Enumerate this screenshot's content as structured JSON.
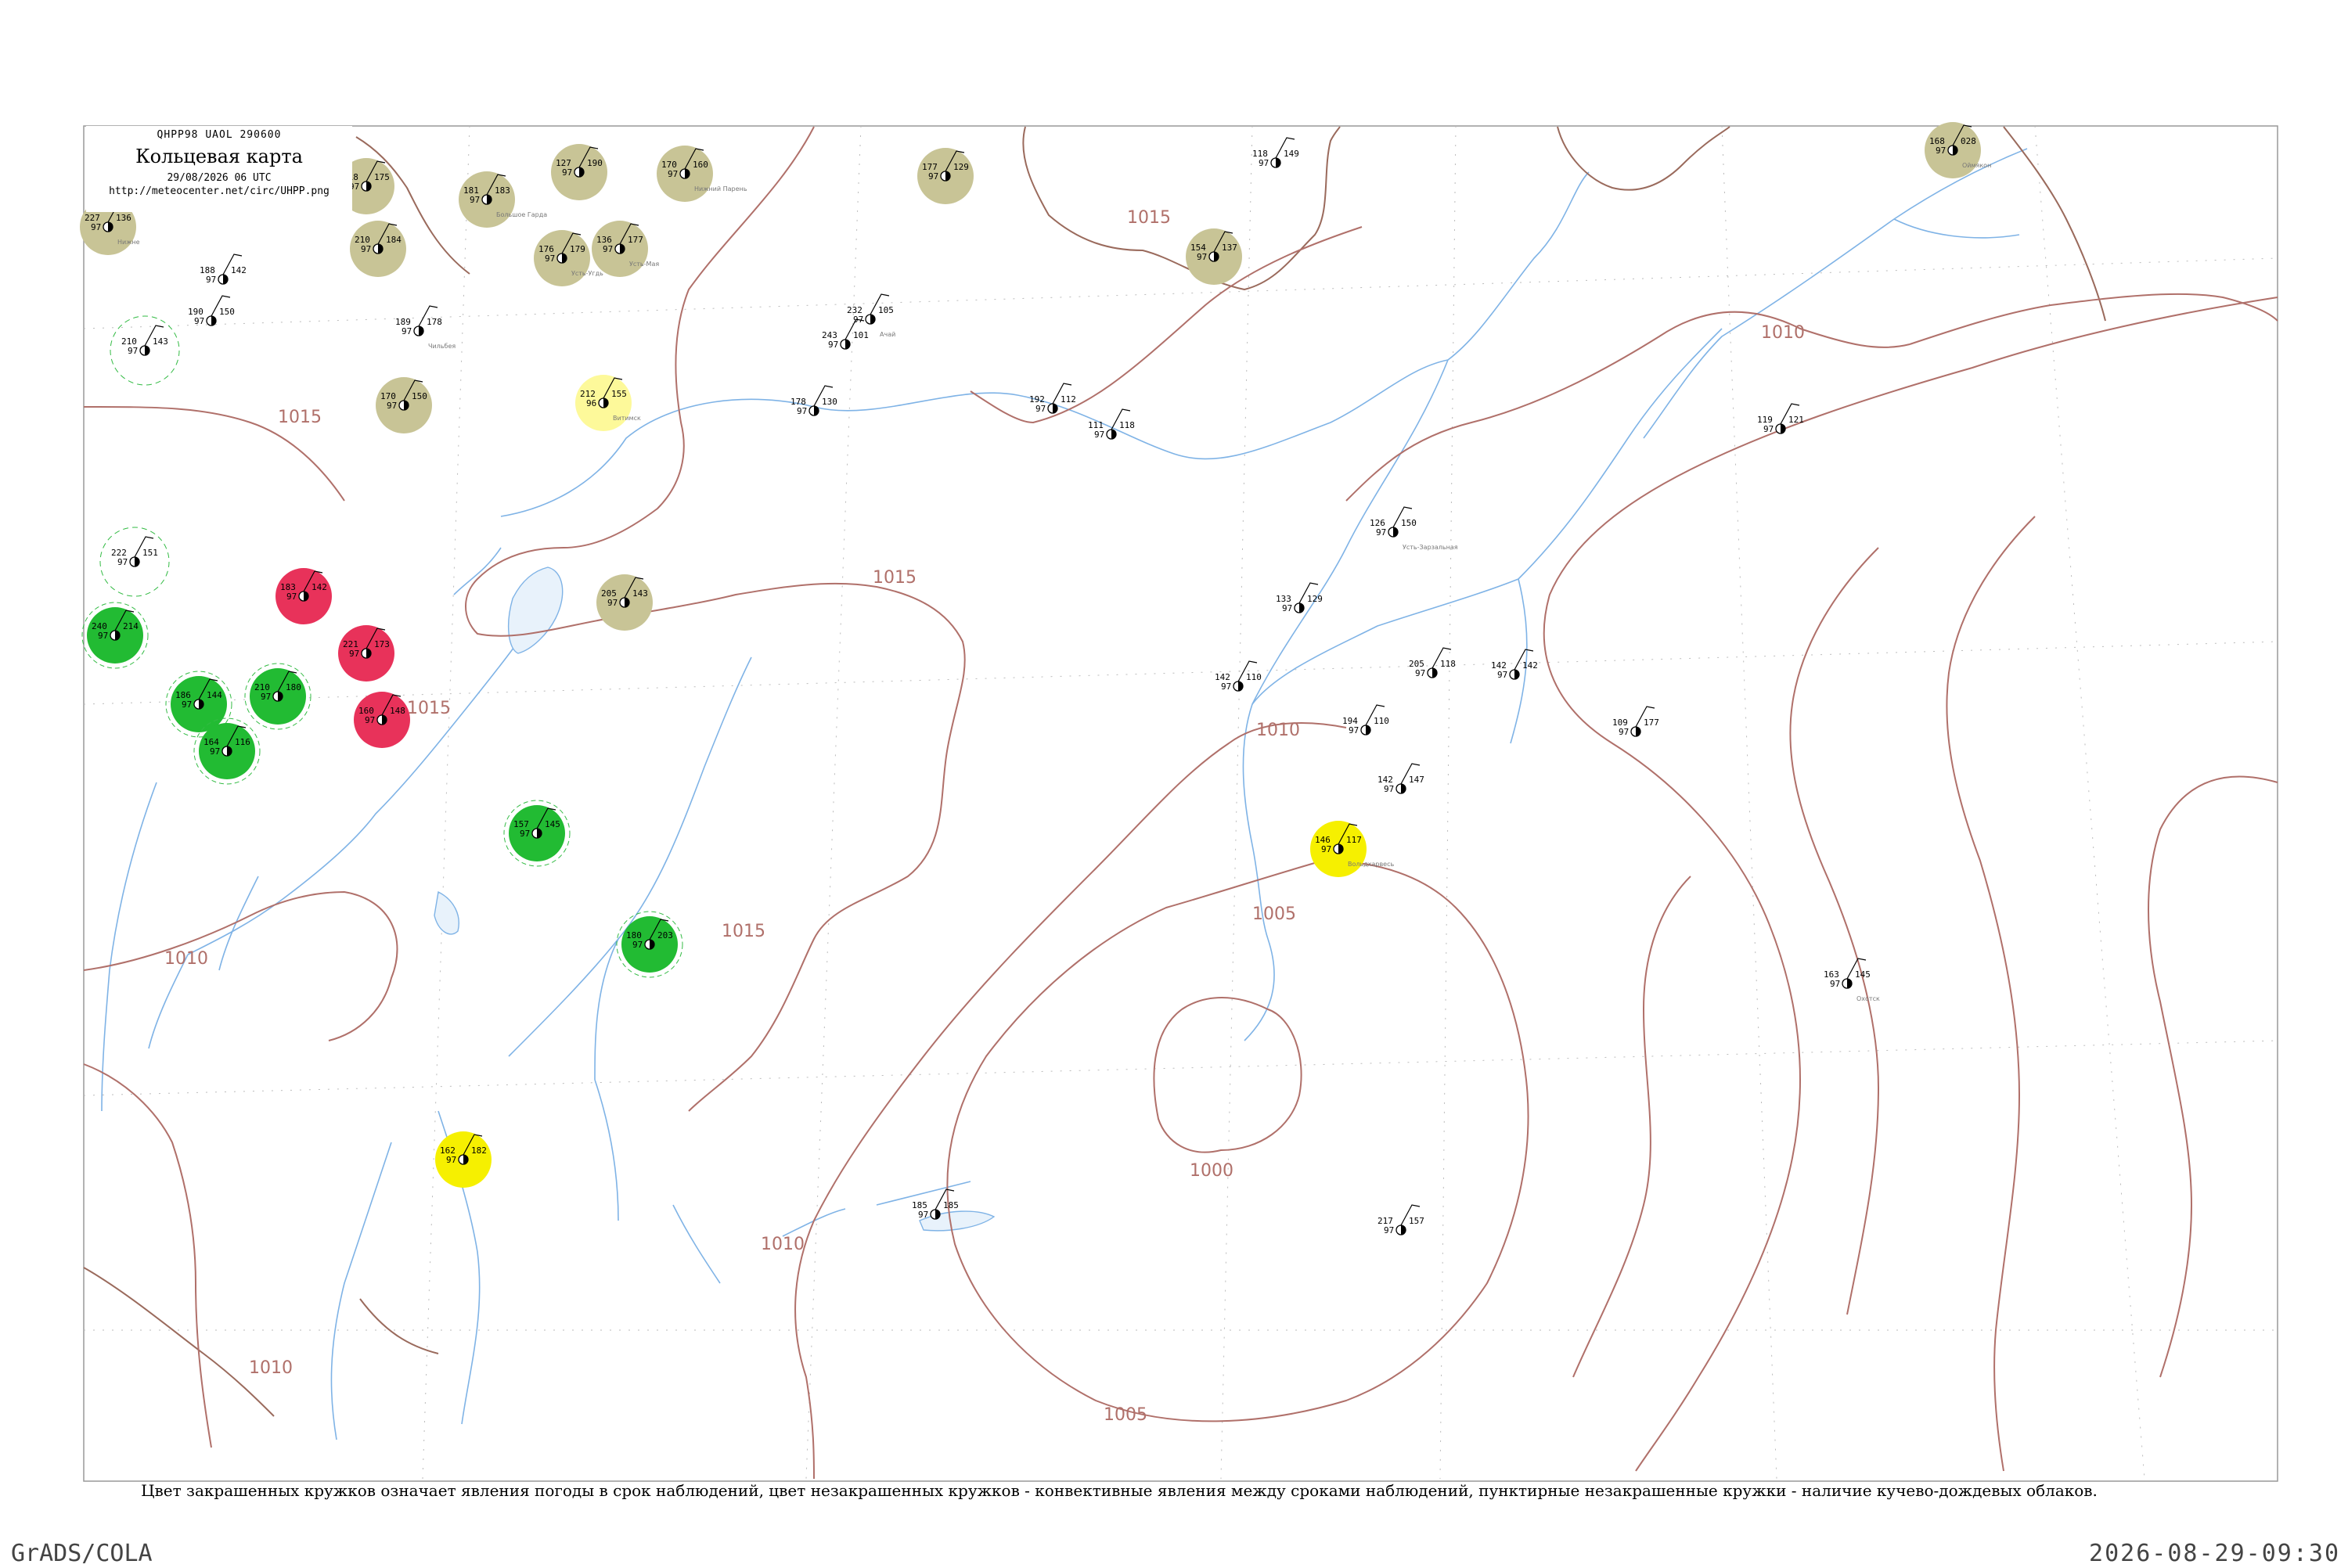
{
  "header": {
    "code": "QHPP98  UAOL  290600",
    "title": "Кольцевая карта",
    "datetime": "29/08/2026 06 UTC",
    "url": "http://meteocenter.net/circ/UHPP.png"
  },
  "caption": "Цвет закрашенных кружков означает явления погоды в срок наблюдений, цвет незакрашенных кружков - конвективные явления между сроками наблюдений, пунктирные незакрашенные кружки - наличие кучево-дождевых облаков.",
  "footer": {
    "left": "GrADS/COLA",
    "right": "2026-08-29-09:30"
  },
  "colors": {
    "isobar": "#b0706a",
    "river": "#7fb3e6",
    "khaki": "#c8c496",
    "green": "#22bb33",
    "red": "#e8325a",
    "yellow": "#f6f000",
    "paleyellow": "#fdf99a",
    "dashed": "#33bb44"
  },
  "isobar_labels": [
    "1015",
    "1015",
    "1015",
    "1015",
    "1015",
    "1010",
    "1010",
    "1010",
    "1010",
    "1005",
    "1000",
    "1005",
    "1010"
  ],
  "stations": [
    {
      "temp": "227",
      "td": "136",
      "p": "97",
      "name": "Нижне",
      "kind": "khaki"
    },
    {
      "temp": "218",
      "td": "175",
      "p": "97",
      "name": "",
      "kind": "khaki"
    },
    {
      "temp": "181",
      "td": "183",
      "p": "97",
      "name": "Большое Гарда",
      "kind": "khaki"
    },
    {
      "temp": "127",
      "td": "190",
      "p": "97",
      "name": "",
      "kind": "khaki"
    },
    {
      "temp": "170",
      "td": "160",
      "p": "97",
      "name": "Нижний Парень",
      "kind": "khaki"
    },
    {
      "temp": "210",
      "td": "184",
      "p": "97",
      "name": "",
      "kind": "khaki"
    },
    {
      "temp": "176",
      "td": "179",
      "p": "97",
      "name": "Усть-Угдь",
      "kind": "khaki"
    },
    {
      "temp": "136",
      "td": "177",
      "p": "97",
      "name": "Усть-Мая",
      "kind": "khaki"
    },
    {
      "temp": "177",
      "td": "129",
      "p": "97",
      "name": "",
      "kind": "khaki"
    },
    {
      "temp": "154",
      "td": "137",
      "p": "97",
      "name": "",
      "kind": "khaki"
    },
    {
      "temp": "170",
      "td": "150",
      "p": "97",
      "name": "",
      "kind": "khaki"
    },
    {
      "temp": "205",
      "td": "143",
      "p": "97",
      "name": "",
      "kind": "khaki"
    },
    {
      "temp": "168",
      "td": "028",
      "p": "97",
      "name": "Оймякон",
      "kind": "khaki"
    },
    {
      "temp": "212",
      "td": "155",
      "p": "96",
      "name": "Витимск",
      "kind": "paleyellow"
    },
    {
      "temp": "146",
      "td": "117",
      "p": "97",
      "name": "Вольдхарвесь",
      "kind": "yellow"
    },
    {
      "temp": "162",
      "td": "182",
      "p": "97",
      "name": "",
      "kind": "yellow"
    },
    {
      "temp": "222",
      "td": "151",
      "p": "97",
      "name": "",
      "kind": "dashed"
    },
    {
      "temp": "210",
      "td": "143",
      "p": "97",
      "name": "",
      "kind": "dashed"
    },
    {
      "temp": "240",
      "td": "214",
      "p": "97",
      "name": "",
      "kind": "green"
    },
    {
      "temp": "186",
      "td": "144",
      "p": "97",
      "name": "",
      "kind": "green"
    },
    {
      "temp": "164",
      "td": "116",
      "p": "97",
      "name": "",
      "kind": "green"
    },
    {
      "temp": "210",
      "td": "180",
      "p": "97",
      "name": "",
      "kind": "green"
    },
    {
      "temp": "157",
      "td": "145",
      "p": "97",
      "name": "",
      "kind": "green"
    },
    {
      "temp": "180",
      "td": "203",
      "p": "97",
      "name": "",
      "kind": "green"
    },
    {
      "temp": "183",
      "td": "142",
      "p": "97",
      "name": "",
      "kind": "red"
    },
    {
      "temp": "221",
      "td": "173",
      "p": "97",
      "name": "",
      "kind": "red"
    },
    {
      "temp": "160",
      "td": "148",
      "p": "97",
      "name": "",
      "kind": "red"
    },
    {
      "temp": "188",
      "td": "142",
      "p": "97",
      "name": "",
      "kind": "plain"
    },
    {
      "temp": "190",
      "td": "150",
      "p": "97",
      "name": "",
      "kind": "plain"
    },
    {
      "temp": "189",
      "td": "178",
      "p": "97",
      "name": "Чильбея",
      "kind": "plain"
    },
    {
      "temp": "232",
      "td": "105",
      "p": "97",
      "name": "Ачай",
      "kind": "plain"
    },
    {
      "temp": "243",
      "td": "101",
      "p": "97",
      "name": "",
      "kind": "plain"
    },
    {
      "temp": "178",
      "td": "130",
      "p": "97",
      "name": "",
      "kind": "plain"
    },
    {
      "temp": "192",
      "td": "112",
      "p": "97",
      "name": "",
      "kind": "plain"
    },
    {
      "temp": "111",
      "td": "118",
      "p": "97",
      "name": "",
      "kind": "plain"
    },
    {
      "temp": "118",
      "td": "149",
      "p": "97",
      "name": "",
      "kind": "plain"
    },
    {
      "temp": "119",
      "td": "121",
      "p": "97",
      "name": "",
      "kind": "plain"
    },
    {
      "temp": "126",
      "td": "150",
      "p": "97",
      "name": "Усть-Зарзальная",
      "kind": "plain"
    },
    {
      "temp": "133",
      "td": "129",
      "p": "97",
      "name": "",
      "kind": "plain"
    },
    {
      "temp": "205",
      "td": "118",
      "p": "97",
      "name": "",
      "kind": "plain"
    },
    {
      "temp": "142",
      "td": "142",
      "p": "97",
      "name": "",
      "kind": "plain"
    },
    {
      "temp": "142",
      "td": "110",
      "p": "97",
      "name": "",
      "kind": "plain"
    },
    {
      "temp": "194",
      "td": "110",
      "p": "97",
      "name": "",
      "kind": "plain"
    },
    {
      "temp": "109",
      "td": "177",
      "p": "97",
      "name": "",
      "kind": "plain"
    },
    {
      "temp": "142",
      "td": "147",
      "p": "97",
      "name": "",
      "kind": "plain"
    },
    {
      "temp": "163",
      "td": "145",
      "p": "97",
      "name": "Охотск",
      "kind": "plain"
    },
    {
      "temp": "185",
      "td": "185",
      "p": "97",
      "name": "",
      "kind": "plain"
    },
    {
      "temp": "217",
      "td": "157",
      "p": "97",
      "name": "",
      "kind": "plain"
    }
  ]
}
